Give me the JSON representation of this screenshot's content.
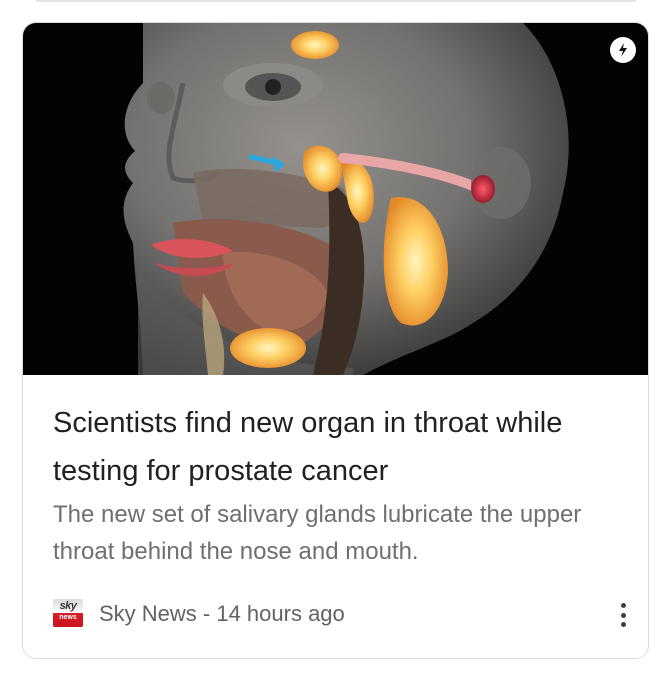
{
  "article": {
    "headline": "Scientists find new organ in throat while testing for prostate cancer",
    "snippet": "The new set of salivary glands lubricate the upper throat behind the nose and mouth.",
    "hero_image_icon": "head-anatomy-illustration",
    "badge_icon": "amp-lightning-icon"
  },
  "source": {
    "favicon_top": "sky",
    "favicon_bottom": "news",
    "meta": "Sky News - 14 hours ago",
    "menu_icon": "more-vert-icon"
  },
  "colors": {
    "headline": "#202124",
    "snippet": "#6f6f6f",
    "meta": "#5f6368",
    "card_border": "#dcdcdc",
    "sky_red": "#d61f26"
  }
}
